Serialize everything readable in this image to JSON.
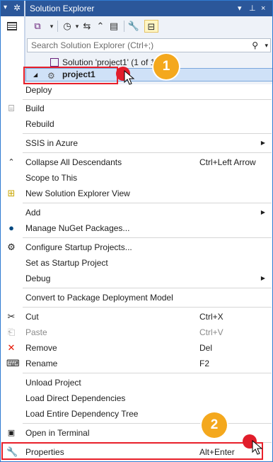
{
  "window": {
    "left_pin": "▾",
    "left_gear": "✲",
    "title": "Solution Explorer",
    "title_controls": [
      "▾",
      "⊥",
      "×"
    ]
  },
  "search": {
    "placeholder": "Search Solution Explorer (Ctrl+;)",
    "search_icon": "⚲",
    "dropdown_icon": "▾"
  },
  "tree": {
    "solution_label": "Solution 'project1' (1 of 1 pr",
    "project_label": "project1"
  },
  "annotations": {
    "step1": "1",
    "step2": "2",
    "highlight_color": "#e8202a",
    "badge_color": "#f4a81d"
  },
  "menu": {
    "deploy": "Deploy",
    "build": "Build",
    "rebuild": "Rebuild",
    "ssis_in_azure": "SSIS in Azure",
    "collapse_all": "Collapse All Descendants",
    "collapse_all_shortcut": "Ctrl+Left Arrow",
    "scope_to_this": "Scope to This",
    "new_view": "New Solution Explorer View",
    "add": "Add",
    "manage_nuget": "Manage NuGet Packages...",
    "configure_startup": "Configure Startup Projects...",
    "set_startup": "Set as Startup Project",
    "debug": "Debug",
    "convert": "Convert to Package Deployment Model",
    "cut": "Cut",
    "cut_shortcut": "Ctrl+X",
    "paste": "Paste",
    "paste_shortcut": "Ctrl+V",
    "remove": "Remove",
    "remove_shortcut": "Del",
    "rename": "Rename",
    "rename_shortcut": "F2",
    "unload": "Unload Project",
    "load_direct": "Load Direct Dependencies",
    "load_entire": "Load Entire Dependency Tree",
    "open_terminal": "Open in Terminal",
    "properties": "Properties",
    "properties_shortcut": "Alt+Enter",
    "submenu_arrow": "▶"
  },
  "colors": {
    "title_bar": "#2b579a",
    "selection": "#cfe1f7",
    "accent": "#2f7bd1"
  }
}
